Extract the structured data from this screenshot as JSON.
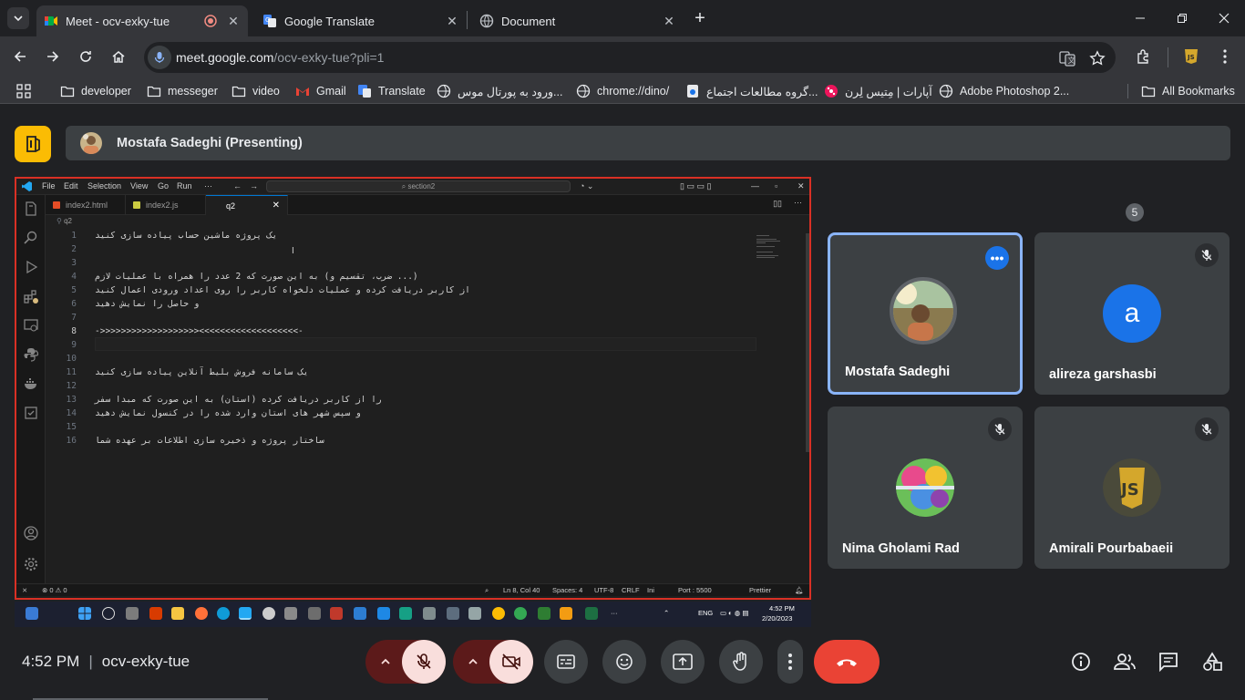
{
  "browser": {
    "tabs": [
      {
        "title": "Meet - ocv-exky-tue",
        "active": true,
        "recording": true
      },
      {
        "title": "Google Translate",
        "active": false
      },
      {
        "title": "Document",
        "active": false
      }
    ],
    "url_host": "meet.google.com",
    "url_path": "/ocv-exky-tue?pli=1",
    "bookmarks": [
      {
        "label": "developer",
        "icon": "folder-icon"
      },
      {
        "label": "messeger",
        "icon": "folder-icon"
      },
      {
        "label": "video",
        "icon": "folder-icon"
      },
      {
        "label": "Gmail",
        "icon": "gmail-icon"
      },
      {
        "label": "Translate",
        "icon": "translate-icon"
      },
      {
        "label": "ورود به پورتال موس...",
        "icon": "globe-icon"
      },
      {
        "label": "chrome://dino/",
        "icon": "globe-icon"
      },
      {
        "label": "گروه مطالعات اجتماع...",
        "icon": "site-icon"
      },
      {
        "label": "آپارات | مِتیس لِرن",
        "icon": "aparat-icon"
      },
      {
        "label": "Adobe Photoshop 2...",
        "icon": "globe-icon"
      },
      {
        "label": "All Bookmarks",
        "icon": "folder-icon"
      }
    ]
  },
  "meet": {
    "presenter": "Mostafa Sadeghi (Presenting)",
    "time": "4:52 PM",
    "meeting_code": "ocv-exky-tue",
    "participant_count": "5",
    "participants": [
      {
        "name": "Mostafa Sadeghi",
        "speaking": true,
        "avatar": "photo"
      },
      {
        "name": "alireza garshasbi",
        "avatar_letter": "a",
        "muted": true
      },
      {
        "name": "Nima Gholami Rad",
        "avatar": "photo",
        "muted": true
      },
      {
        "name": "Amirali Pourbabaeii",
        "avatar": "js-logo",
        "muted": true
      }
    ]
  },
  "vscode": {
    "menu": [
      "File",
      "Edit",
      "Selection",
      "View",
      "Go",
      "Run",
      "···"
    ],
    "search": "section2",
    "tabs": [
      "index2.html",
      "index2.js",
      "q2"
    ],
    "breadcrumb": "q2",
    "lines": [
      "یک پروژه ماشین حساب پیاده سازی کنید",
      "",
      "",
      "(... ضرب، تقسیم و) به این صورت که 2 عدد را همراه با عملیات لازم",
      "از کاربر دریافت کرده و عملیات دلخواه کاربر را روی اعداد ورودی اعمال کنید",
      " و حاصل را نمایش دهید",
      "",
      "->>>>>>>>>>>>>>>>>>><<<<<<<<<<<<<<<<<<<-",
      "",
      "",
      "یک سامانه فروش بلیط آنلاین پیاده سازی کنید",
      "",
      "را از کاربر دریافت کرده (استان) به این صورت که مبدا سفر",
      " و سپس شهر های استان وارد شده را در کنسول نمایش دهید",
      "",
      "ساختار پروژه و ذخیره سازی اطلاعات بر عهده شما"
    ],
    "current_line": 8,
    "status": {
      "problems": "⊗ 0 ⚠ 0",
      "position": "Ln 8, Col 40",
      "spaces": "Spaces: 4",
      "encoding": "UTF-8",
      "eol": "CRLF",
      "lang": "Ini",
      "port": "Port : 5500",
      "prettier": "Prettier"
    },
    "taskbar": {
      "lang": "ENG",
      "time": "4:52 PM",
      "date": "2/20/2023"
    }
  },
  "colors": {
    "accent": "#8ab4f8",
    "danger": "#ea4335",
    "presenting_frame": "#d93025",
    "meet_logo": "#fbbc04"
  }
}
